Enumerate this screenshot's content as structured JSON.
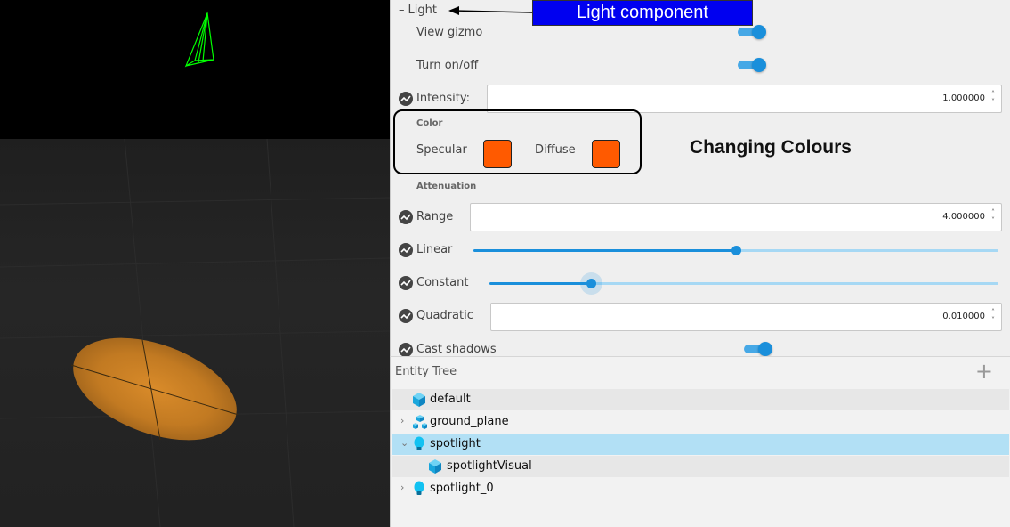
{
  "inspector": {
    "section_title": "Light",
    "view_gizmo_label": "View gizmo",
    "turn_on_off_label": "Turn on/off",
    "intensity_label": "Intensity:",
    "intensity_value": "1.000000",
    "color_label": "Color",
    "specular_label": "Specular",
    "diffuse_label": "Diffuse",
    "specular_color": "#ff5a00",
    "diffuse_color": "#ff5a00",
    "attenuation_label": "Attenuation",
    "range_label": "Range",
    "range_value": "4.000000",
    "linear_label": "Linear",
    "linear_level": 0.5,
    "constant_label": "Constant",
    "constant_level": 0.2,
    "quadratic_label": "Quadratic",
    "quadratic_value": "0.010000",
    "cast_shadows_label": "Cast shadows",
    "view_gizmo_on": true,
    "turn_on_off_on": true,
    "cast_shadows_on": true
  },
  "annotations": {
    "banner": "Light component",
    "changing_colours": "Changing Colours"
  },
  "entity_tree": {
    "title": "Entity Tree",
    "add_symbol": "+",
    "items": [
      {
        "label": "default",
        "icon": "cube-icon",
        "expandable": false
      },
      {
        "label": "ground_plane",
        "icon": "model-icon",
        "expandable": true
      },
      {
        "label": "spotlight",
        "icon": "lightbulb-icon",
        "expandable": true,
        "expanded": true,
        "selected": true
      },
      {
        "label": "spotlightVisual",
        "icon": "cube-icon",
        "expandable": false
      },
      {
        "label": "spotlight_0",
        "icon": "lightbulb-icon",
        "expandable": true
      }
    ]
  },
  "colors": {
    "accent": "#1a8fdb",
    "selection": "#b2e0f5",
    "gizmo": "#00ff00",
    "lit_spot": "#e3952e"
  }
}
